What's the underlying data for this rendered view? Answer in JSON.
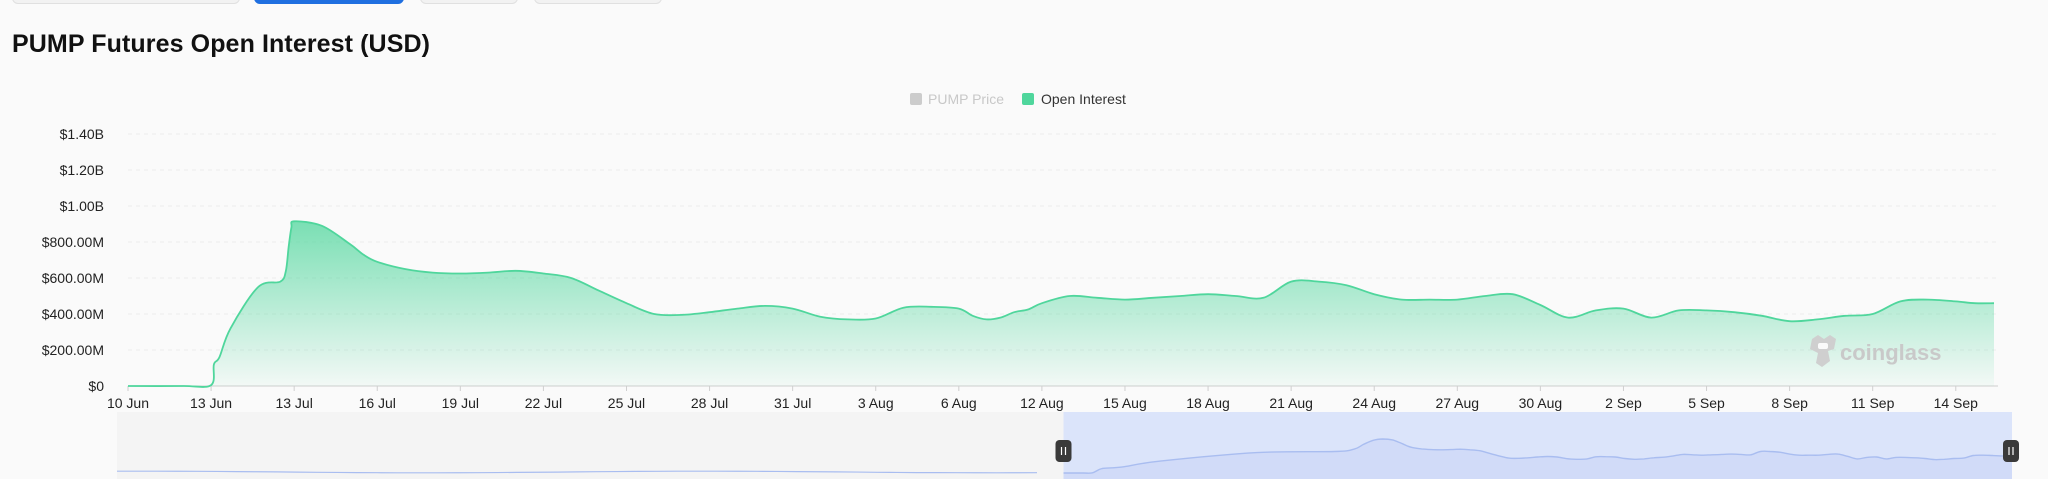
{
  "page": {
    "title": "PUMP Futures Open Interest (USD)"
  },
  "colors": {
    "open_interest": "#4fd69c",
    "pump_price_legend": "#cccccc",
    "navigator_fill": "#dbe4fa",
    "navigator_line": "#a9bdf0"
  },
  "legend": {
    "items": [
      {
        "label": "PUMP Price",
        "color": "#cccccc",
        "active": false
      },
      {
        "label": "Open Interest",
        "color": "#4fd69c",
        "active": true
      }
    ]
  },
  "watermark": {
    "text": "coinglass",
    "icon": "coinglass-logo-icon"
  },
  "navigator": {
    "range_start_fraction": 0.5,
    "range_end_fraction": 1.0,
    "handle_icon": "drag-handle-icon"
  },
  "chart_data": {
    "type": "area",
    "x_label": "",
    "y_label": "",
    "ylim": [
      0,
      1400000000
    ],
    "xlim": [
      "2025-06-10",
      "2025-09-16"
    ],
    "x_ticks": [
      {
        "date": "2025-06-10",
        "label": "10 Jun"
      },
      {
        "date": "2025-06-13",
        "label": "13 Jun"
      },
      {
        "date": "2025-07-13",
        "label": "13 Jul"
      },
      {
        "date": "2025-07-16",
        "label": "16 Jul"
      },
      {
        "date": "2025-07-19",
        "label": "19 Jul"
      },
      {
        "date": "2025-07-22",
        "label": "22 Jul"
      },
      {
        "date": "2025-07-25",
        "label": "25 Jul"
      },
      {
        "date": "2025-07-28",
        "label": "28 Jul"
      },
      {
        "date": "2025-07-31",
        "label": "31 Jul"
      },
      {
        "date": "2025-08-03",
        "label": "3 Aug"
      },
      {
        "date": "2025-08-06",
        "label": "6 Aug"
      },
      {
        "date": "2025-08-12",
        "label": "12 Aug"
      },
      {
        "date": "2025-08-15",
        "label": "15 Aug"
      },
      {
        "date": "2025-08-18",
        "label": "18 Aug"
      },
      {
        "date": "2025-08-21",
        "label": "21 Aug"
      },
      {
        "date": "2025-08-24",
        "label": "24 Aug"
      },
      {
        "date": "2025-08-27",
        "label": "27 Aug"
      },
      {
        "date": "2025-08-30",
        "label": "30 Aug"
      },
      {
        "date": "2025-09-02",
        "label": "2 Sep"
      },
      {
        "date": "2025-09-05",
        "label": "5 Sep"
      },
      {
        "date": "2025-09-08",
        "label": "8 Sep"
      },
      {
        "date": "2025-09-11",
        "label": "11 Sep"
      },
      {
        "date": "2025-09-14",
        "label": "14 Sep"
      }
    ],
    "y_ticks": [
      {
        "value": 0,
        "label": "$0"
      },
      {
        "value": 200000000,
        "label": "$200.00M"
      },
      {
        "value": 400000000,
        "label": "$400.00M"
      },
      {
        "value": 600000000,
        "label": "$600.00M"
      },
      {
        "value": 800000000,
        "label": "$800.00M"
      },
      {
        "value": 1000000000,
        "label": "$1.00B"
      },
      {
        "value": 1200000000,
        "label": "$1.20B"
      },
      {
        "value": 1400000000,
        "label": "$1.40B"
      }
    ],
    "grid": true,
    "legend_position": "top-center",
    "series": [
      {
        "name": "Open Interest",
        "x": [
          "2025-06-10",
          "2025-06-12",
          "2025-06-13",
          "2025-06-14",
          "2025-06-16",
          "2025-06-20",
          "2025-06-30",
          "2025-07-08",
          "2025-07-10",
          "2025-07-11",
          "2025-07-12",
          "2025-07-13",
          "2025-07-14",
          "2025-07-15",
          "2025-07-15T12",
          "2025-07-16",
          "2025-07-17",
          "2025-07-18",
          "2025-07-19",
          "2025-07-20",
          "2025-07-21",
          "2025-07-22",
          "2025-07-23",
          "2025-07-24",
          "2025-07-25",
          "2025-07-26",
          "2025-07-27",
          "2025-07-28",
          "2025-07-29",
          "2025-07-30",
          "2025-07-31",
          "2025-08-01",
          "2025-08-02",
          "2025-08-03",
          "2025-08-04",
          "2025-08-05",
          "2025-08-06",
          "2025-08-07",
          "2025-08-08",
          "2025-08-09",
          "2025-08-10",
          "2025-08-11",
          "2025-08-12",
          "2025-08-13",
          "2025-08-14",
          "2025-08-15",
          "2025-08-16",
          "2025-08-17",
          "2025-08-18",
          "2025-08-19",
          "2025-08-20",
          "2025-08-21",
          "2025-08-22",
          "2025-08-23",
          "2025-08-24",
          "2025-08-25",
          "2025-08-26",
          "2025-08-27",
          "2025-08-28",
          "2025-08-29",
          "2025-08-30",
          "2025-08-31",
          "2025-09-01",
          "2025-09-02",
          "2025-09-03",
          "2025-09-04",
          "2025-09-05",
          "2025-09-06",
          "2025-09-07",
          "2025-09-08",
          "2025-09-09",
          "2025-09-10",
          "2025-09-11",
          "2025-09-12",
          "2025-09-13",
          "2025-09-14",
          "2025-09-15",
          "2025-09-16"
        ],
        "values": [
          0,
          0,
          5000000,
          120000000,
          160000000,
          320000000,
          550000000,
          580000000,
          640000000,
          770000000,
          880000000,
          915000000,
          890000000,
          790000000,
          730000000,
          690000000,
          650000000,
          630000000,
          625000000,
          630000000,
          640000000,
          625000000,
          600000000,
          530000000,
          460000000,
          400000000,
          395000000,
          410000000,
          430000000,
          445000000,
          430000000,
          385000000,
          370000000,
          375000000,
          435000000,
          440000000,
          430000000,
          390000000,
          370000000,
          380000000,
          410000000,
          425000000,
          460000000,
          500000000,
          490000000,
          480000000,
          490000000,
          500000000,
          510000000,
          500000000,
          490000000,
          580000000,
          580000000,
          560000000,
          510000000,
          480000000,
          480000000,
          480000000,
          500000000,
          510000000,
          450000000,
          380000000,
          420000000,
          430000000,
          380000000,
          420000000,
          420000000,
          410000000,
          390000000,
          360000000,
          370000000,
          390000000,
          400000000,
          470000000,
          480000000,
          470000000,
          460000000,
          460000000
        ]
      }
    ]
  }
}
